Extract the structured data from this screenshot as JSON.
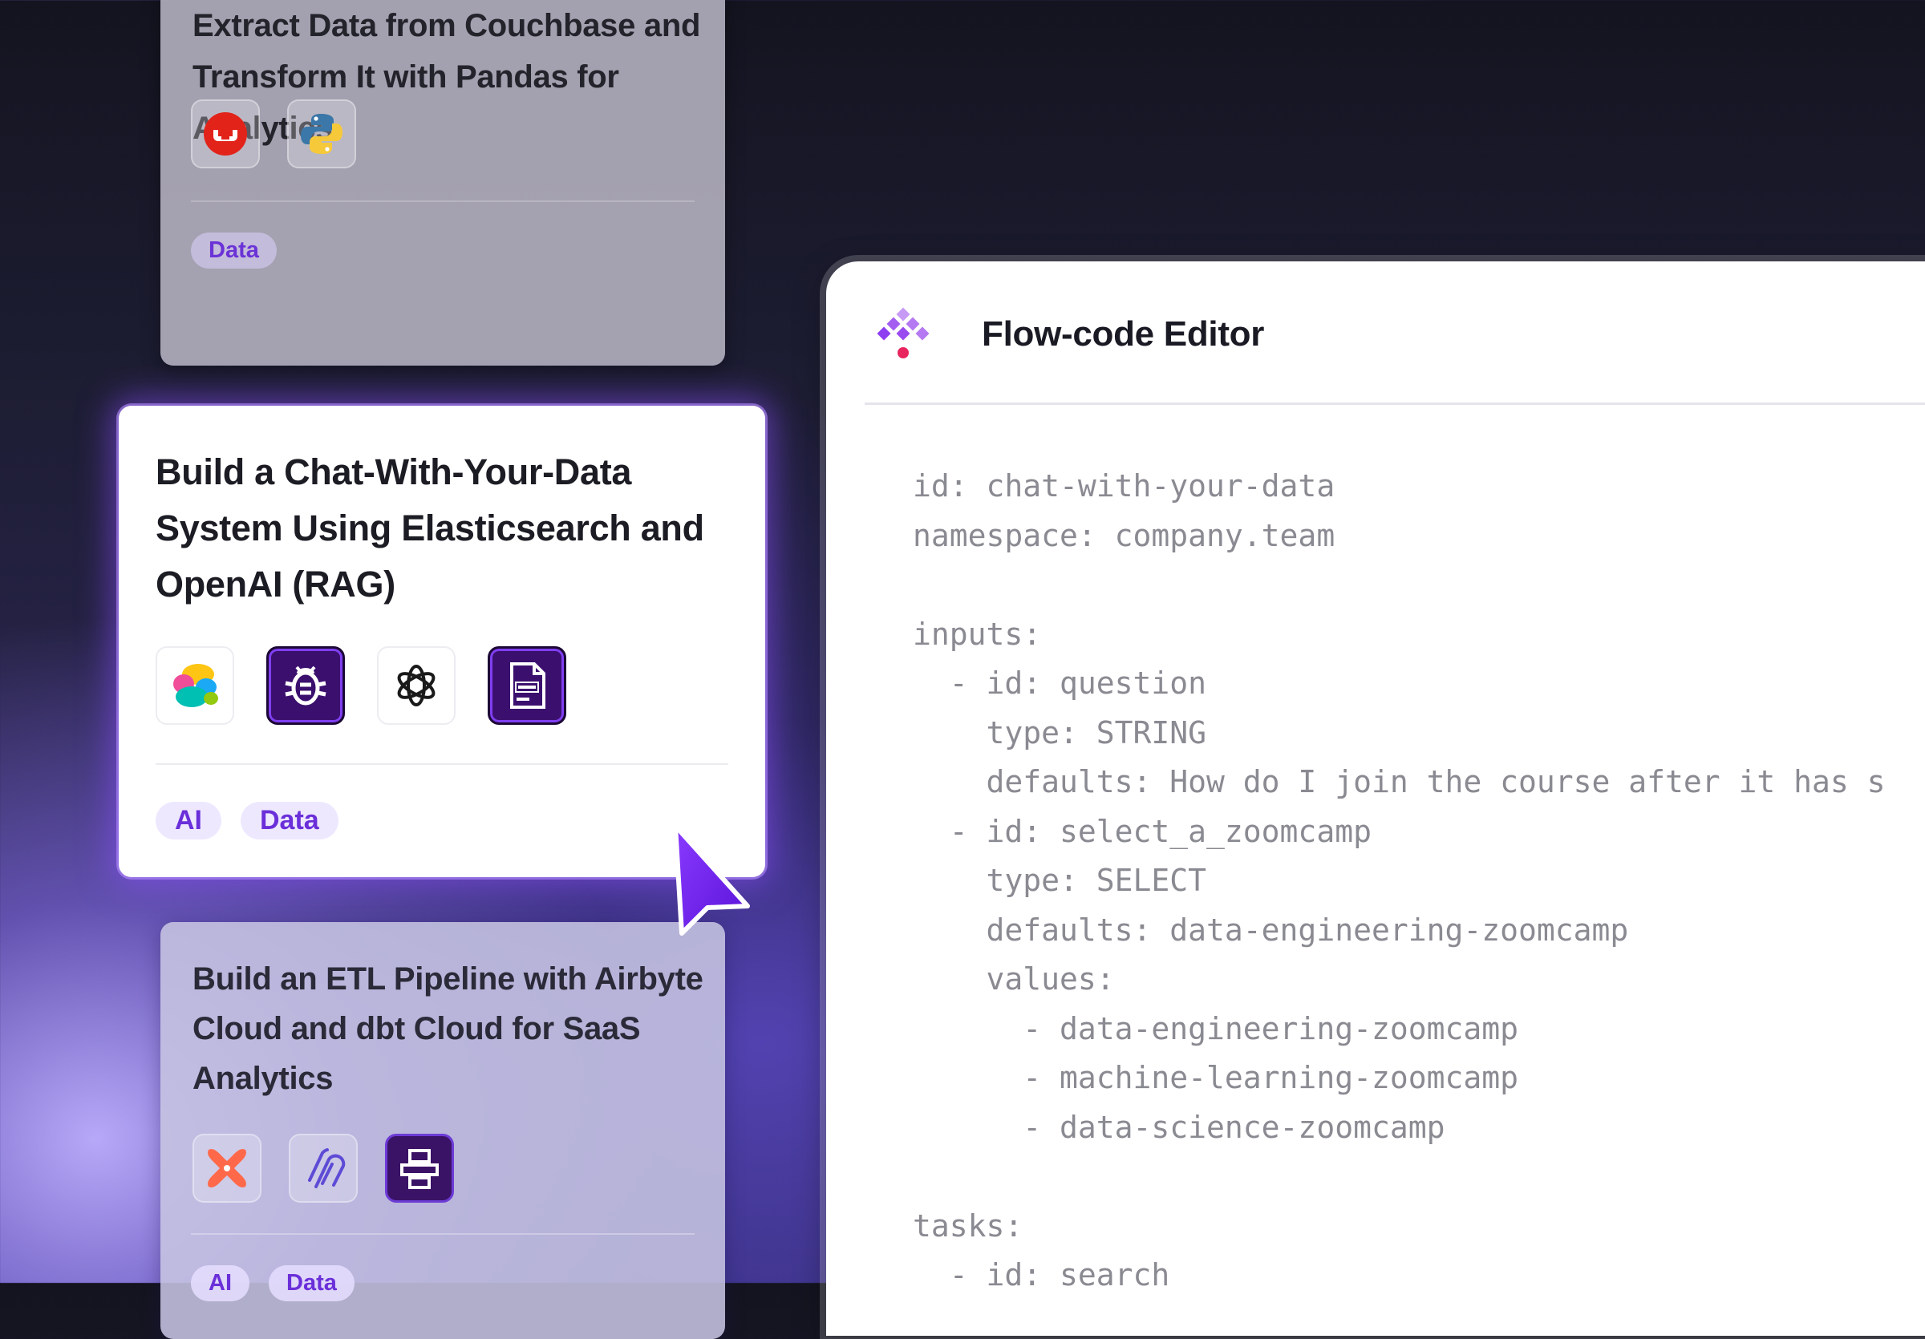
{
  "cards": [
    {
      "title": "Extract Data from Couchbase and Transform It with Pandas for Analytics",
      "icons": [
        "couchbase-icon",
        "python-icon"
      ],
      "tags": [
        "Data"
      ]
    },
    {
      "title": "Build a Chat-With-Your-Data System Using Elasticsearch and OpenAI (RAG)",
      "icons": [
        "elasticsearch-icon",
        "debug-bug-icon",
        "openai-icon",
        "log-file-icon"
      ],
      "tags": [
        "AI",
        "Data"
      ]
    },
    {
      "title": "Build an ETL Pipeline with Airbyte Cloud and dbt Cloud for SaaS Analytics",
      "icons": [
        "dbt-icon",
        "airbyte-icon",
        "flow-icon"
      ],
      "tags": [
        "AI",
        "Data"
      ]
    }
  ],
  "editor": {
    "title": "Flow-code Editor",
    "code_lines": [
      "id: chat-with-your-data",
      "namespace: company.team",
      "",
      "inputs:",
      "  - id: question",
      "    type: STRING",
      "    defaults: How do I join the course after it has s",
      "  - id: select_a_zoomcamp",
      "    type: SELECT",
      "    defaults: data-engineering-zoomcamp",
      "    values:",
      "      - data-engineering-zoomcamp",
      "      - machine-learning-zoomcamp",
      "      - data-science-zoomcamp",
      "",
      "tasks:",
      "  - id: search"
    ]
  },
  "colors": {
    "accent": "#7b2ff7",
    "tag_text": "#6a2fd9",
    "tag_bg": "#eee8ff"
  }
}
